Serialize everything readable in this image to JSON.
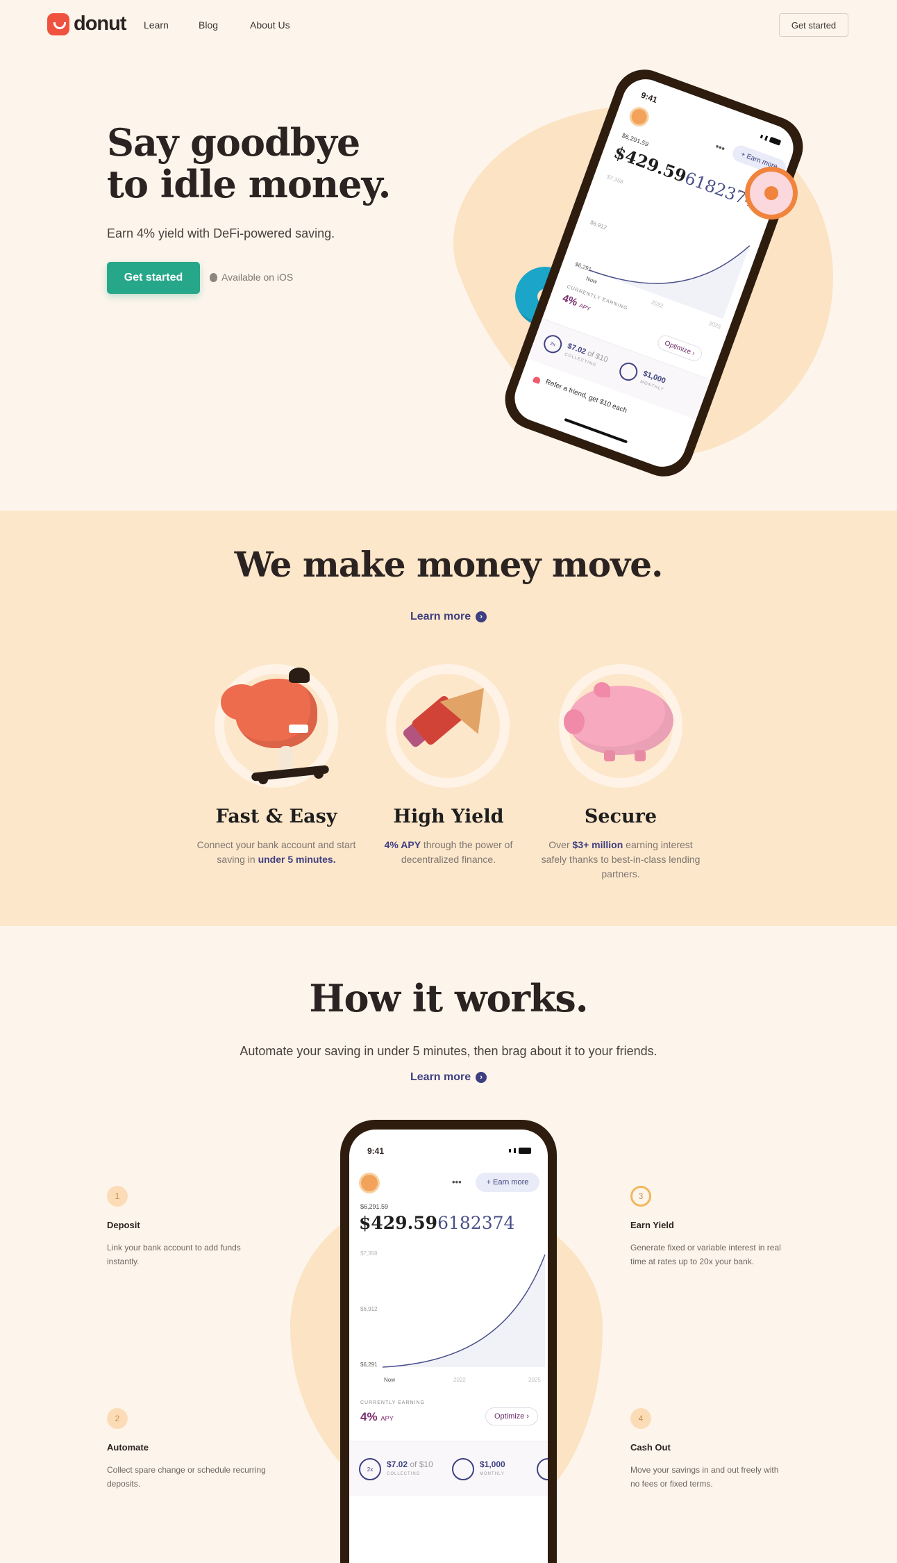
{
  "nav": {
    "brand": "donut",
    "links": [
      "Learn",
      "Blog",
      "About Us"
    ],
    "cta": "Get started"
  },
  "hero": {
    "title_line1": "Say goodbye",
    "title_line2": "to idle money.",
    "subtitle": "Earn 4% yield with DeFi-powered saving.",
    "cta": "Get started",
    "ios": "Available on iOS"
  },
  "phone": {
    "time": "9:41",
    "earn_more": "+ Earn more",
    "deposited": "$6,291.59",
    "balance_main": "$429.59",
    "balance_tail": "6182374",
    "axis_top": "$7,358",
    "axis_mid": "$6,912",
    "axis_low": "$6,291",
    "x_now": "Now",
    "x_2022": "2022",
    "x_2025": "2025",
    "earning_label": "CURRENTLY EARNING",
    "apy_value": "4%",
    "apy_unit": "APY",
    "optimize": "Optimize ›",
    "ring1_label": "2x",
    "card1_value": "$7.02",
    "card1_of": "of $10",
    "card1_sub": "COLLECTING",
    "card2_value": "$1,000",
    "card2_sub": "MONTHLY",
    "refer": "Refer a friend, get $10 each"
  },
  "features": {
    "title": "We make money move.",
    "learn_more": "Learn more",
    "items": [
      {
        "title": "Fast & Easy",
        "pre": "Connect your bank account and start saving in ",
        "highlight": "under 5 minutes.",
        "post": ""
      },
      {
        "title": "High Yield",
        "pre": "",
        "highlight": "4% APY",
        "post": " through the power of decentralized finance."
      },
      {
        "title": "Secure",
        "pre": "Over ",
        "highlight": "$3+ million",
        "post": " earning interest safely thanks to best-in-class lending partners."
      }
    ]
  },
  "how": {
    "title": "How it works.",
    "subtitle": "Automate your saving in under 5 minutes, then brag about it to your friends.",
    "learn_more": "Learn more",
    "steps": [
      {
        "num": "1",
        "title": "Deposit",
        "text": "Link your bank account to add funds instantly."
      },
      {
        "num": "2",
        "title": "Automate",
        "text": "Collect spare change or schedule recurring deposits."
      },
      {
        "num": "3",
        "title": "Earn Yield",
        "text": "Generate fixed or variable interest in real time at rates up to 20x your bank."
      },
      {
        "num": "4",
        "title": "Cash Out",
        "text": "Move your savings in and out freely with no fees or fixed terms."
      }
    ]
  },
  "colors": {
    "brand_red": "#ef5340",
    "cta_green": "#27a789",
    "link_indigo": "#3e3f80",
    "band_peach": "#fde7cb"
  }
}
